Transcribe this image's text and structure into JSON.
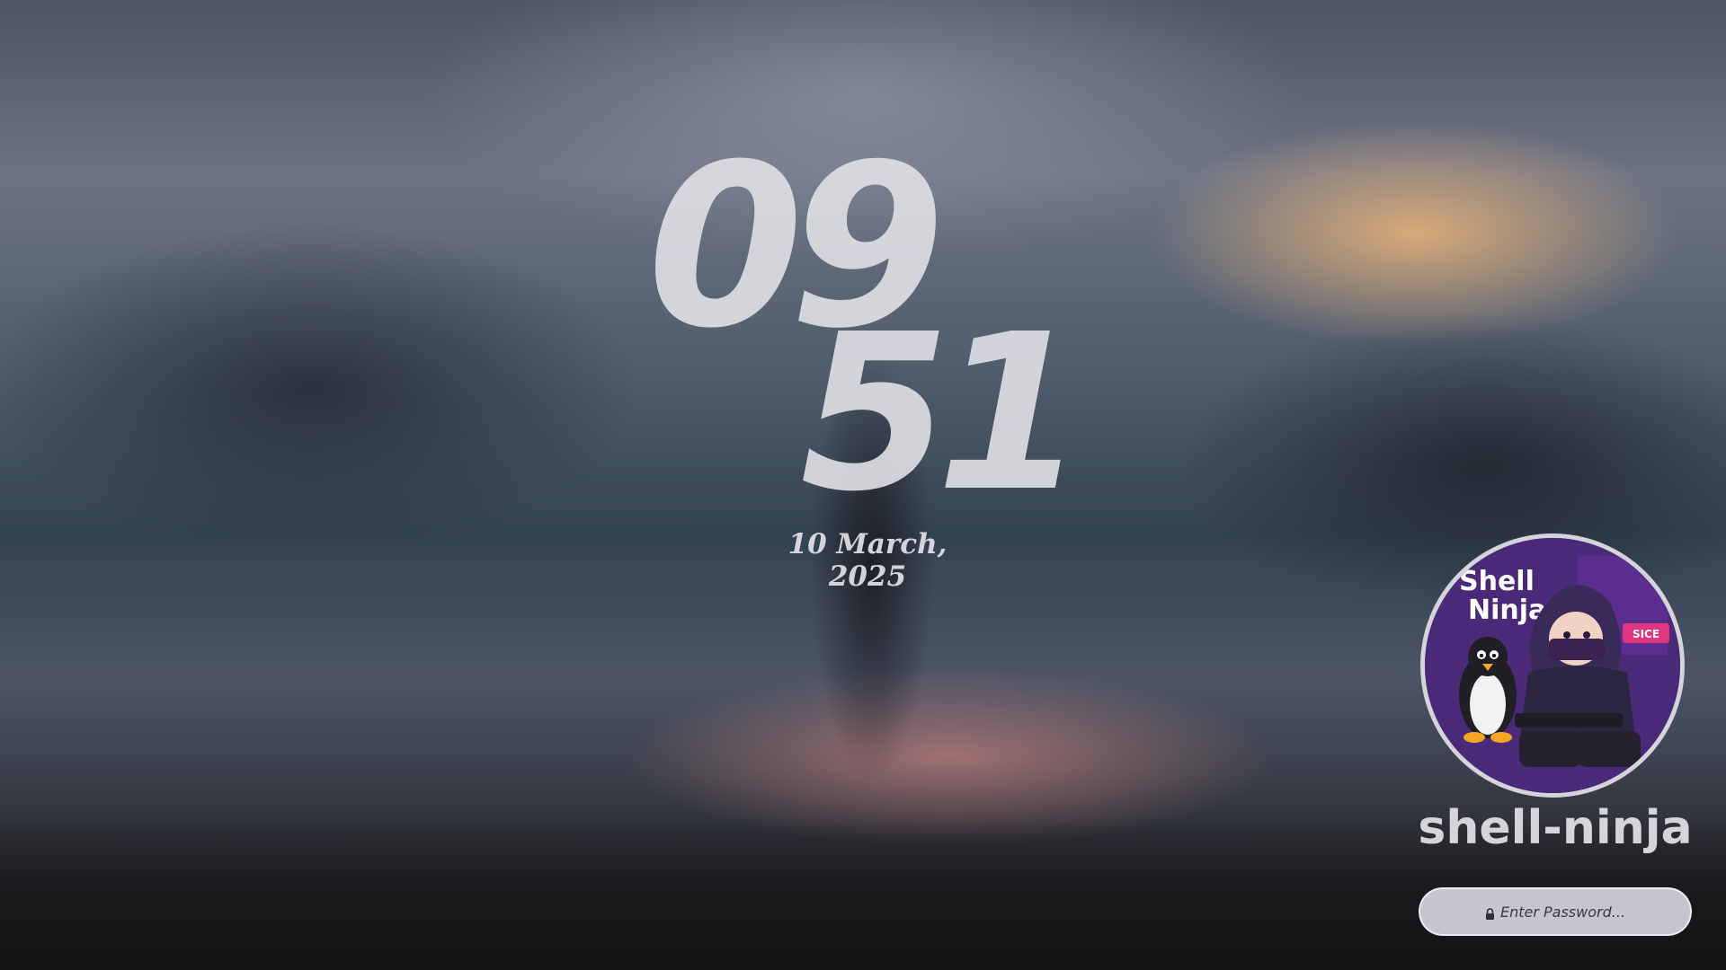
{
  "clock": {
    "hours": "09",
    "minutes": "51"
  },
  "date": {
    "text": "10 March, 2025"
  },
  "user": {
    "name": "shell-ninja",
    "avatar_text_line1": "Shell",
    "avatar_text_line2": "Ninja",
    "avatar_sign_text": "SICE"
  },
  "password": {
    "placeholder": "Enter Password..."
  },
  "icons": {
    "lock": "lock-icon"
  },
  "colors": {
    "text": "#dedee4",
    "field_background": "#d6d6de",
    "avatar_border": "#d4d4da",
    "avatar_accent": "#6a3fa0"
  }
}
